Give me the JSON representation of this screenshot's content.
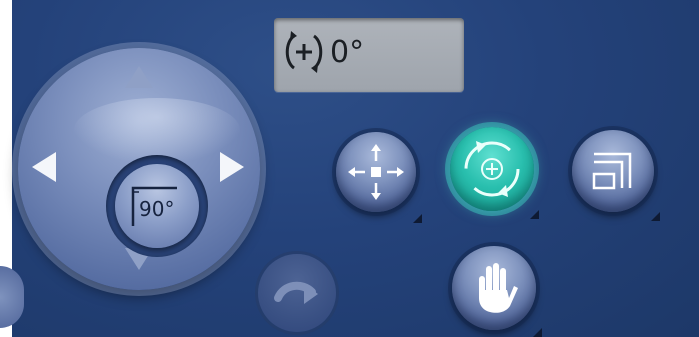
{
  "rotation_readout": {
    "value": "0°",
    "icon": "rotate-cw-icon"
  },
  "dpad": {
    "center_label": "90°",
    "up_icon": "arrow-up-icon",
    "down_icon": "arrow-down-icon",
    "left_icon": "arrow-left-icon",
    "right_icon": "arrow-right-icon"
  },
  "toolbar": {
    "move": {
      "icon": "move-arrows-icon"
    },
    "rotate": {
      "icon": "rotate-icon",
      "active": true
    },
    "scale": {
      "icon": "scale-icon"
    },
    "pan": {
      "icon": "hand-icon"
    },
    "undo": {
      "icon": "redo-arrow-icon",
      "enabled": false
    }
  },
  "colors": {
    "panel": "#24427a",
    "button": "#7f93be",
    "active_teal": "#29bfae",
    "readout_bg": "#a7adb5"
  }
}
